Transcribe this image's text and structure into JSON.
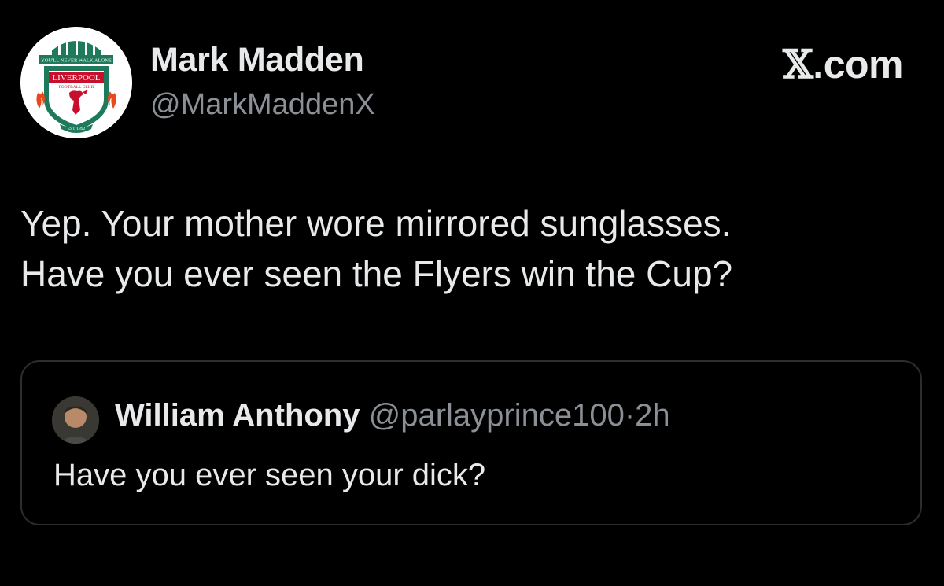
{
  "author": {
    "name": "Mark Madden",
    "handle": "@MarkMaddenX",
    "avatar_icon": "liverpool-fc-crest-icon",
    "avatar_text": {
      "top_banner": "YOU'LL NEVER WALK ALONE",
      "club": "LIVERPOOL",
      "subtitle": "FOOTBALL CLUB",
      "est": "EST·1892"
    }
  },
  "brand": {
    "x": "𝕏",
    "domain": ".com"
  },
  "tweet": {
    "lines": [
      "Yep. Your mother wore mirrored sunglasses.",
      "Have you ever seen the Flyers win the Cup?"
    ]
  },
  "quoted": {
    "name": "William Anthony",
    "handle": "@parlayprince100",
    "separator": "·",
    "time": "2h",
    "text": "Have you ever seen your dick?",
    "avatar_icon": "user-photo-icon"
  },
  "colors": {
    "background": "#000000",
    "text": "#e7e9ea",
    "secondary": "#8b9096",
    "border": "#2a2d31",
    "crest_red": "#c8102e",
    "crest_green": "#1e7a5a"
  }
}
